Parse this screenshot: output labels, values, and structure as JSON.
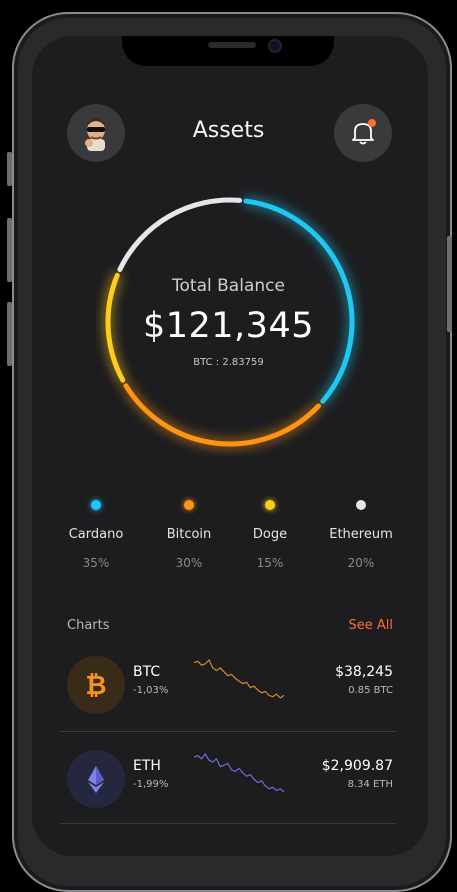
{
  "header": {
    "title": "Assets"
  },
  "balance": {
    "label": "Total Balance",
    "amount": "$121,345",
    "btc": "BTC : 2.83759"
  },
  "allocation": [
    {
      "name": "Cardano",
      "percent": "35%",
      "color": "#1fc8f2"
    },
    {
      "name": "Bitcoin",
      "percent": "30%",
      "color": "#ff9414"
    },
    {
      "name": "Doge",
      "percent": "15%",
      "color": "#ffcc1a"
    },
    {
      "name": "Ethereum",
      "percent": "20%",
      "color": "#e6e6e8"
    }
  ],
  "charts": {
    "label": "Charts",
    "see_all": "See All",
    "items": [
      {
        "symbol": "BTC",
        "change": "-1,03%",
        "price": "$38,245",
        "holding": "0.85 BTC",
        "icon": "bitcoin-icon",
        "spark_color": "#d98a2b",
        "spark": [
          8,
          7,
          10,
          9,
          6,
          12,
          14,
          12,
          15,
          18,
          17,
          20,
          22,
          24,
          23,
          27,
          26,
          29,
          31,
          30,
          33,
          34,
          32,
          35,
          33
        ]
      },
      {
        "symbol": "ETH",
        "change": "-1,99%",
        "price": "$2,909.87",
        "holding": "8.34 ETH",
        "icon": "ethereum-icon",
        "spark_color": "#6a6fd6",
        "spark": [
          10,
          9,
          11,
          8,
          12,
          13,
          11,
          16,
          15,
          14,
          18,
          19,
          17,
          20,
          22,
          21,
          24,
          26,
          25,
          28,
          30,
          29,
          31,
          30,
          32
        ]
      }
    ]
  },
  "notifications": {
    "has_unread": true,
    "dot_color": "#ff6a3d"
  }
}
